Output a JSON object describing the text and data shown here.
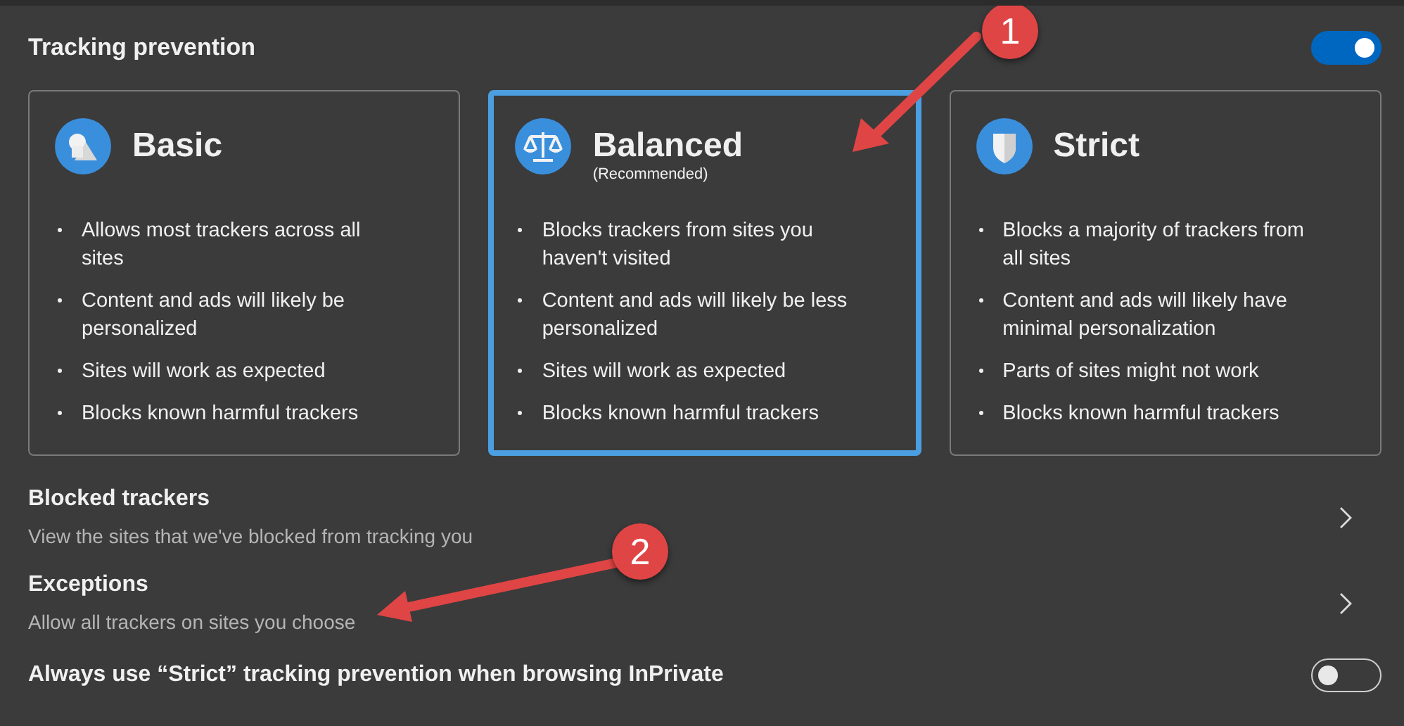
{
  "section": {
    "title": "Tracking prevention",
    "toggle": {
      "on": true
    }
  },
  "levels": [
    {
      "kind": "basic",
      "title": "Basic",
      "selected": false,
      "bullets": [
        "Allows most trackers across all sites",
        "Content and ads will likely be personalized",
        "Sites will work as expected",
        "Blocks known harmful trackers"
      ]
    },
    {
      "kind": "balanced",
      "title": "Balanced",
      "subtitle": "(Recommended)",
      "selected": true,
      "bullets": [
        "Blocks trackers from sites you haven't visited",
        "Content and ads will likely be less personalized",
        "Sites will work as expected",
        "Blocks known harmful trackers"
      ]
    },
    {
      "kind": "strict",
      "title": "Strict",
      "selected": false,
      "bullets": [
        "Blocks a majority of trackers from all sites",
        "Content and ads will likely have minimal personalization",
        "Parts of sites might not work",
        "Blocks known harmful trackers"
      ]
    }
  ],
  "rows": [
    {
      "kind": "link",
      "title": "Blocked trackers",
      "description": "View the sites that we've blocked from tracking you"
    },
    {
      "kind": "link",
      "title": "Exceptions",
      "description": "Allow all trackers on sites you choose"
    },
    {
      "kind": "toggle",
      "title": "Always use “Strict” tracking prevention when browsing InPrivate",
      "on": false
    }
  ],
  "annotations": [
    {
      "label": "1"
    },
    {
      "label": "2"
    }
  ]
}
